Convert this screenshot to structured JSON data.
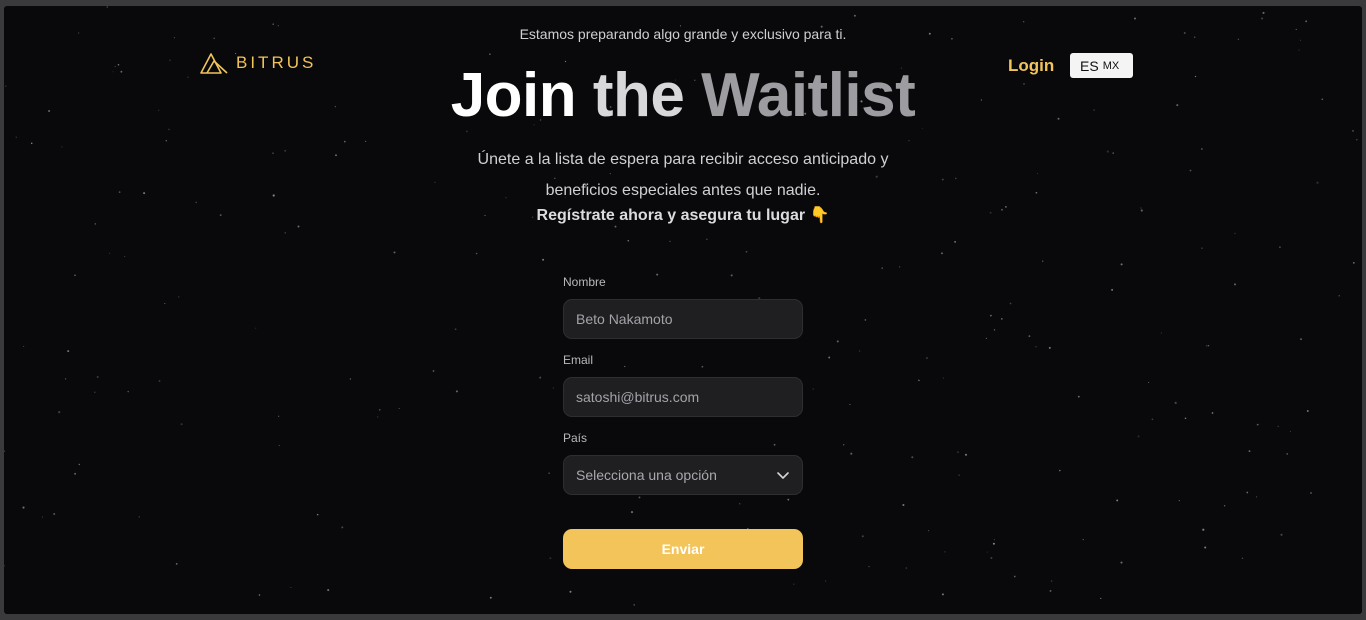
{
  "announcement": "Estamos preparando algo grande y exclusivo para ti.",
  "brand": {
    "name": "BITRUS",
    "accent_color": "#f2c45a",
    "logo_icon": "mountain-logo-icon"
  },
  "nav": {
    "login_label": "Login",
    "language": {
      "code": "ES",
      "region": "MX"
    }
  },
  "hero": {
    "title_word_1": "Join",
    "title_word_2": "the",
    "title_word_3": "Waitlist",
    "subtitle_line_1": "Únete a la lista de espera para recibir acceso anticipado y",
    "subtitle_line_2": "beneficios especiales antes que nadie.",
    "cta_text": "Regístrate ahora y asegura tu lugar",
    "cta_emoji": "👇"
  },
  "form": {
    "name_label": "Nombre",
    "name_placeholder": "Beto Nakamoto",
    "email_label": "Email",
    "email_placeholder": "satoshi@bitrus.com",
    "country_label": "País",
    "country_placeholder": "Selecciona una opción",
    "country_icon": "chevron-down-icon",
    "submit_label": "Enviar"
  },
  "colors": {
    "background": "#09090b",
    "input_bg": "#1f1f22",
    "button_bg": "#f2c45a"
  }
}
